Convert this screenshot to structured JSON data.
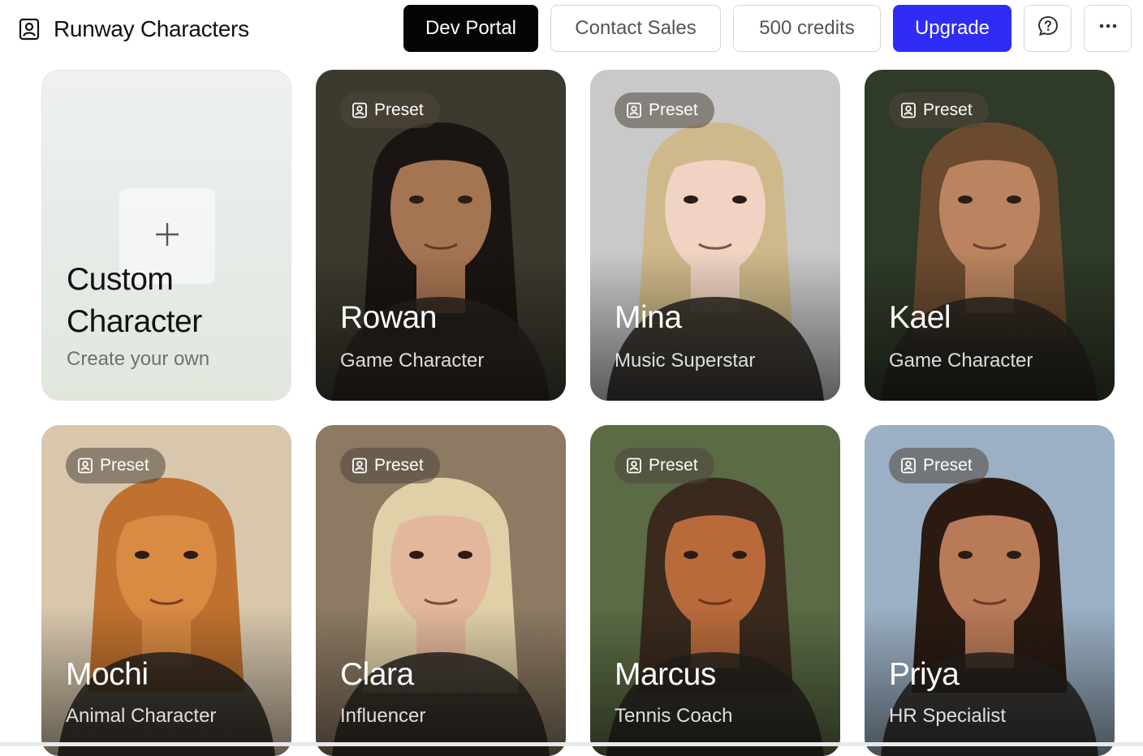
{
  "app": {
    "title": "Runway Characters",
    "icon": "character-portrait-icon"
  },
  "header": {
    "dev_portal": "Dev Portal",
    "contact_sales": "Contact Sales",
    "credits": "500 credits",
    "upgrade": "Upgrade",
    "help_icon": "chat-question-icon",
    "more_icon": "more-dots-icon"
  },
  "colors": {
    "upgrade": "#2f2cf5",
    "dev_portal": "#050505"
  },
  "custom_card": {
    "icon": "plus-icon",
    "title_line1": "Custom",
    "title_line2": "Character",
    "subtitle": "Create your own"
  },
  "cards": [
    {
      "badge": "Preset",
      "name": "Rowan",
      "role": "Game Character",
      "bg": "#3c3a2e",
      "skin": "#a57452",
      "hair": "#1a1512"
    },
    {
      "badge": "Preset",
      "name": "Mina",
      "role": "Music Superstar",
      "bg": "#c9c9c9",
      "skin": "#f0d3c2",
      "hair": "#cfb98a"
    },
    {
      "badge": "Preset",
      "name": "Kael",
      "role": "Game Character",
      "bg": "#2f3a28",
      "skin": "#b9845f",
      "hair": "#6b4b2f"
    },
    {
      "badge": "Preset",
      "name": "Mochi",
      "role": "Animal Character",
      "bg": "#d8c7ad",
      "skin": "#d98a43",
      "hair": "#c0712f"
    },
    {
      "badge": "Preset",
      "name": "Clara",
      "role": "Influencer",
      "bg": "#8c7a62",
      "skin": "#e3b79b",
      "hair": "#e0d0a8"
    },
    {
      "badge": "Preset",
      "name": "Marcus",
      "role": "Tennis Coach",
      "bg": "#5a6b45",
      "skin": "#b86a3b",
      "hair": "#3a2a1e"
    },
    {
      "badge": "Preset",
      "name": "Priya",
      "role": "HR Specialist",
      "bg": "#9bb0c4",
      "skin": "#b97a58",
      "hair": "#2a1a12"
    }
  ]
}
